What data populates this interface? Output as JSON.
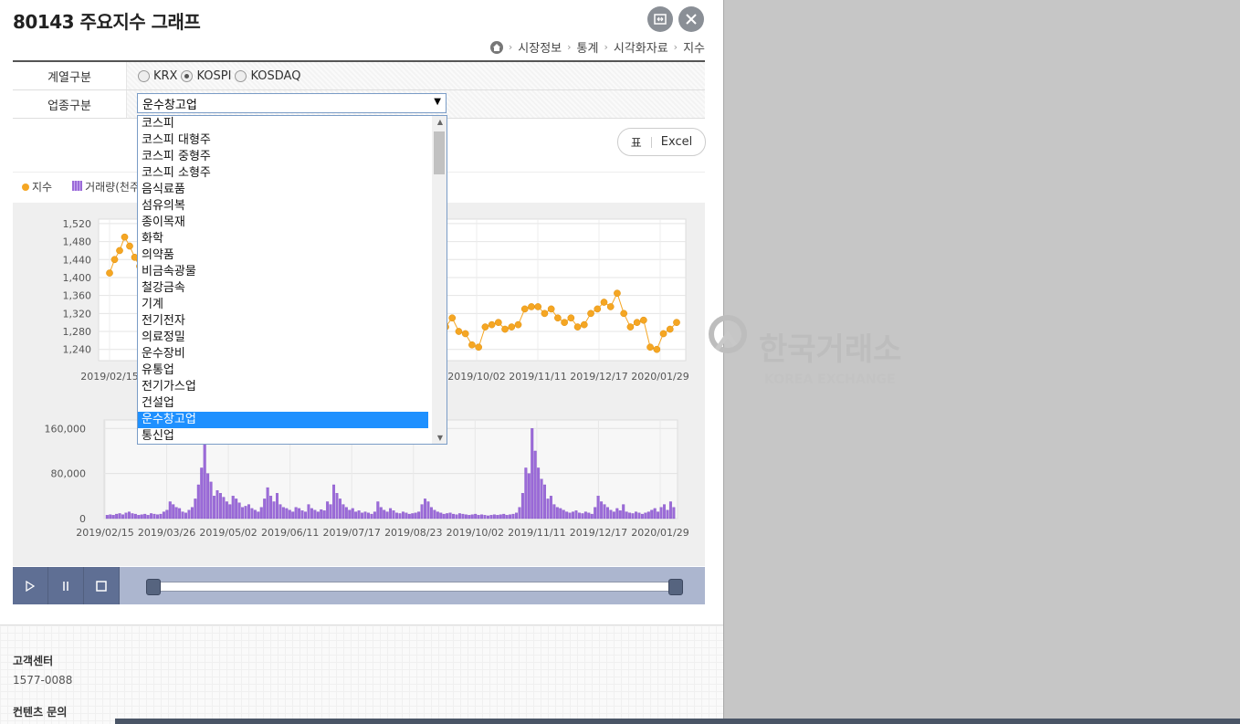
{
  "title": "80143 주요지수 그래프",
  "breadcrumb": [
    "시장정보",
    "통계",
    "시각화자료",
    "지수"
  ],
  "form": {
    "series_label": "계열구분",
    "radios": [
      {
        "label": "KRX",
        "checked": false
      },
      {
        "label": "KOSPI",
        "checked": true
      },
      {
        "label": "KOSDAQ",
        "checked": false
      }
    ],
    "sector_label": "업종구분",
    "sector_value": "운수창고업"
  },
  "dropdown": {
    "options": [
      "코스피",
      "코스피 대형주",
      "코스피 중형주",
      "코스피 소형주",
      "음식료품",
      "섬유의복",
      "종이목재",
      "화학",
      "의약품",
      "비금속광물",
      "철강금속",
      "기계",
      "전기전자",
      "의료정밀",
      "운수장비",
      "유통업",
      "전기가스업",
      "건설업",
      "운수창고업",
      "통신업"
    ],
    "selected": "운수창고업"
  },
  "buttons": {
    "table_label": "표",
    "excel_label": "Excel"
  },
  "legend": {
    "index_label": "지수",
    "volume_label": "거래량(천주)"
  },
  "icons": {
    "expand": "expand-icon",
    "close": "close-icon",
    "home": "home-icon",
    "play": "play-icon",
    "pause": "pause-icon",
    "stop": "stop-icon"
  },
  "colors": {
    "index_series": "#f5a623",
    "volume_series": "#9b6bd8",
    "player_bg": "#5f6f94"
  },
  "chart_data": [
    {
      "type": "line",
      "series": [
        {
          "name": "지수"
        }
      ],
      "y_ticks": [
        1240,
        1280,
        1320,
        1360,
        1400,
        1440,
        1480,
        1520
      ],
      "y_tick_labels": [
        "1,240",
        "1,280",
        "1,320",
        "1,360",
        "1,400",
        "1,440",
        "1,480",
        "1,520"
      ],
      "x_tick_labels": [
        "2019/02/15",
        "2019/03/26",
        "2019/05/02",
        "2019/06/11",
        "2019/07/17",
        "2019/08/23",
        "2019/10/02",
        "2019/11/11",
        "2019/12/17",
        "2020/01/29"
      ],
      "ylim": [
        1215,
        1530
      ],
      "x": [
        "2019/02/15",
        "2019/02/20",
        "2019/02/25",
        "2019/02/28",
        "2019/03/05",
        "2019/03/08",
        "2019/03/13",
        "2019/03/18",
        "2019/09/16",
        "2019/09/19",
        "2019/09/24",
        "2019/09/27",
        "2019/10/02",
        "2019/10/07",
        "2019/10/10",
        "2019/10/15",
        "2019/10/18",
        "2019/10/23",
        "2019/10/28",
        "2019/10/31",
        "2019/11/05",
        "2019/11/08",
        "2019/11/13",
        "2019/11/18",
        "2019/11/21",
        "2019/11/26",
        "2019/11/29",
        "2019/12/04",
        "2019/12/09",
        "2019/12/12",
        "2019/12/17",
        "2019/12/20",
        "2019/12/26",
        "2019/12/31",
        "2020/01/06",
        "2020/01/09",
        "2020/01/14",
        "2020/01/17",
        "2020/01/22",
        "2020/01/28",
        "2020/01/31",
        "2020/02/05",
        "2020/02/10",
        "2020/02/13"
      ],
      "values": [
        1410,
        1440,
        1460,
        1490,
        1470,
        1445,
        1425,
        1415,
        1290,
        1310,
        1280,
        1275,
        1250,
        1245,
        1290,
        1295,
        1300,
        1285,
        1290,
        1295,
        1330,
        1335,
        1335,
        1320,
        1330,
        1310,
        1300,
        1310,
        1290,
        1295,
        1320,
        1330,
        1345,
        1335,
        1365,
        1320,
        1290,
        1300,
        1305,
        1245,
        1240,
        1275,
        1285,
        1300
      ]
    },
    {
      "type": "bar",
      "series": [
        {
          "name": "거래량(천주)"
        }
      ],
      "y_ticks": [
        0,
        80000,
        160000
      ],
      "y_tick_labels": [
        "0",
        "80,000",
        "160,000"
      ],
      "x_tick_labels": [
        "2019/02/15",
        "2019/03/26",
        "2019/05/02",
        "2019/06/11",
        "2019/07/17",
        "2019/08/23",
        "2019/10/02",
        "2019/11/11",
        "2019/12/17",
        "2020/01/29"
      ],
      "ylim": [
        0,
        175000
      ],
      "values": [
        6000,
        7000,
        6000,
        8000,
        9000,
        7000,
        10000,
        12000,
        9000,
        8000,
        6000,
        7000,
        8000,
        6000,
        9000,
        8000,
        7000,
        8000,
        12000,
        15000,
        30000,
        25000,
        20000,
        18000,
        12000,
        10000,
        15000,
        20000,
        35000,
        60000,
        90000,
        140000,
        80000,
        65000,
        40000,
        50000,
        45000,
        38000,
        30000,
        25000,
        40000,
        35000,
        28000,
        20000,
        22000,
        25000,
        18000,
        15000,
        12000,
        20000,
        35000,
        55000,
        40000,
        30000,
        45000,
        25000,
        20000,
        18000,
        15000,
        12000,
        20000,
        18000,
        14000,
        12000,
        25000,
        18000,
        15000,
        12000,
        16000,
        14000,
        30000,
        25000,
        60000,
        45000,
        35000,
        25000,
        20000,
        15000,
        18000,
        12000,
        14000,
        10000,
        12000,
        10000,
        8000,
        12000,
        30000,
        20000,
        15000,
        12000,
        18000,
        14000,
        10000,
        9000,
        12000,
        10000,
        8000,
        9000,
        10000,
        12000,
        25000,
        35000,
        30000,
        20000,
        15000,
        12000,
        10000,
        8000,
        9000,
        10000,
        8000,
        7000,
        9000,
        8000,
        7000,
        6000,
        7000,
        8000,
        6000,
        7000,
        6000,
        5000,
        6000,
        7000,
        6000,
        7000,
        8000,
        6000,
        7000,
        8000,
        10000,
        20000,
        45000,
        90000,
        80000,
        160000,
        120000,
        90000,
        70000,
        60000,
        35000,
        40000,
        25000,
        20000,
        18000,
        15000,
        12000,
        10000,
        12000,
        14000,
        10000,
        9000,
        12000,
        10000,
        8000,
        20000,
        40000,
        30000,
        25000,
        20000,
        15000,
        12000,
        18000,
        14000,
        25000,
        12000,
        10000,
        9000,
        12000,
        10000,
        8000,
        10000,
        12000,
        15000,
        18000,
        12000,
        20000,
        25000,
        15000,
        30000,
        20000
      ]
    }
  ]
}
